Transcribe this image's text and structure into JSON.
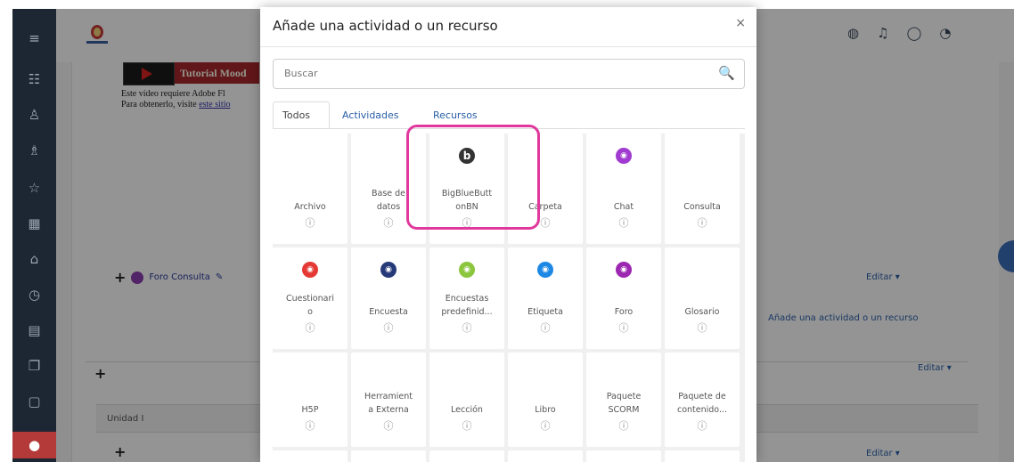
{
  "modal": {
    "title": "Añade una actividad o un recurso",
    "close": "×",
    "search_placeholder": "Buscar",
    "tabs": [
      "Todos",
      "Actividades",
      "Recursos"
    ],
    "info_glyph": "ⓘ",
    "items": [
      {
        "label": "Archivo",
        "icon": ""
      },
      {
        "label": "Base de\ndatos",
        "icon": ""
      },
      {
        "label": "BigBlueButt\nonBN",
        "icon": "b",
        "color": "#333333"
      },
      {
        "label": "Carpeta",
        "icon": ""
      },
      {
        "label": "Chat",
        "icon": "chat-icon",
        "color": "#a03ad0"
      },
      {
        "label": "Consulta",
        "icon": ""
      },
      {
        "label": "Cuestionari\no",
        "icon": "quiz-icon",
        "color": "#e53935"
      },
      {
        "label": "Encuesta",
        "icon": "survey-icon",
        "color": "#263a7a"
      },
      {
        "label": "Encuestas\npredefinid...",
        "icon": "feedback-icon",
        "color": "#8cc63f"
      },
      {
        "label": "Etiqueta",
        "icon": "label-icon",
        "color": "#1e88e5"
      },
      {
        "label": "Foro",
        "icon": "forum-icon",
        "color": "#9c27b0"
      },
      {
        "label": "Glosario",
        "icon": ""
      },
      {
        "label": "H5P",
        "icon": ""
      },
      {
        "label": "Herramient\na Externa",
        "icon": ""
      },
      {
        "label": "Lección",
        "icon": ""
      },
      {
        "label": "Libro",
        "icon": ""
      },
      {
        "label": "Paquete\nSCORM",
        "icon": ""
      },
      {
        "label": "Paquete de\ncontenido...",
        "icon": ""
      }
    ]
  },
  "background": {
    "video_title": "Tutorial Mood",
    "video_line1": "Este vídeo requiere Adobe Fl",
    "video_line2_text": "Para obtenerlo, visite ",
    "video_line2_link": "este sitio",
    "forum_link": "Foro Consulta",
    "add_activity": "Añade una actividad o un recurso",
    "editar": "Editar ▾",
    "unidad": "Unidad I"
  },
  "colors": {
    "highlight": "#e0389c",
    "sidebar": "#1d2733",
    "sidebar_active": "#b43a3a",
    "link": "#2a5fa8"
  }
}
